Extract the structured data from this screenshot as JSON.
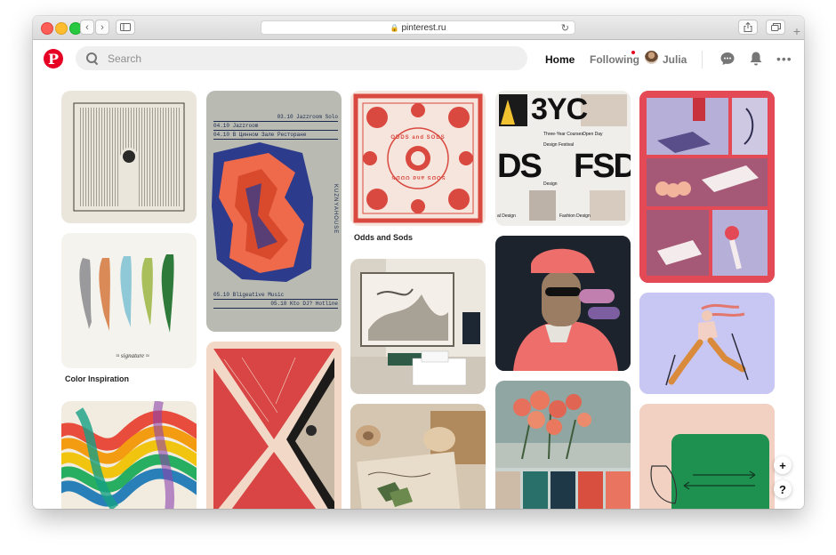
{
  "browser": {
    "url": "pinterest.ru",
    "back_glyph": "‹",
    "forward_glyph": "›",
    "reload_glyph": "↻",
    "new_tab_glyph": "+"
  },
  "header": {
    "logo_letter": "P",
    "search_placeholder": "Search",
    "home_label": "Home",
    "following_label": "Following",
    "user_name": "Julia",
    "more_label": "•••",
    "accent_color": "#e60023"
  },
  "pins": {
    "odds_caption": "Odds and Sods",
    "color_caption": "Color Inspiration",
    "poster_lines": [
      "03.10 Jazzroom Solo",
      "04.10 Jazzroom",
      "04.10 В Цинном Зале Ресторане",
      "05.10 Bligeative Music",
      "05.10 Kto DJ? Hotline"
    ],
    "poster_vertical": "KUZNYAHOUSE",
    "design_big_top": "3YC",
    "design_big_left": "DS",
    "design_big_right": "FSD",
    "design_three_year": "Three-Year Courses",
    "design_open_day": "Open Day",
    "design_festival": "Design Festival",
    "design_fashion": "Fashion Design",
    "design_design": "Design",
    "design_all": "al Design",
    "bandana_top": "ODDS and SODS",
    "bandana_bottom": "SODS and ODDS"
  },
  "floating": {
    "add_label": "+",
    "help_label": "?"
  }
}
